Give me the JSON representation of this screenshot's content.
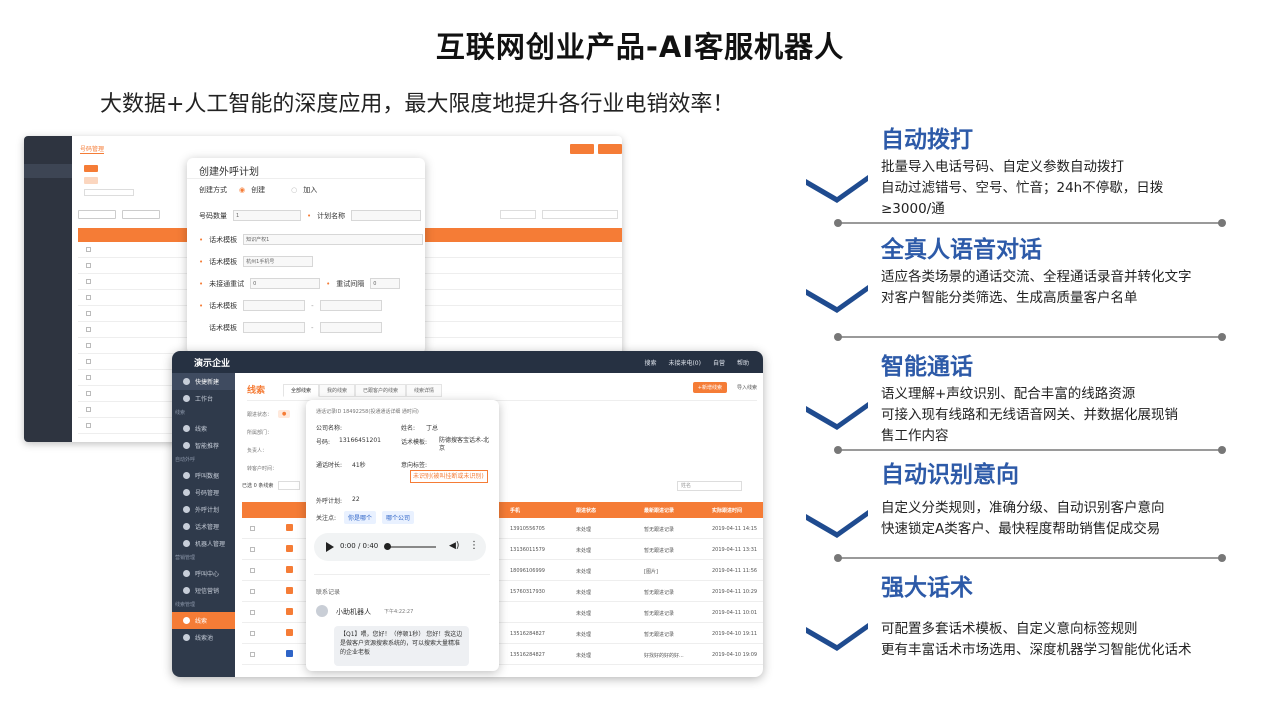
{
  "header": {
    "title": "互联网创业产品-AI客服机器人",
    "subtitle": "大数据+人工智能的深度应用，最大限度地提升各行业电销效率！"
  },
  "shot1": {
    "tabs": [
      "号码管理"
    ],
    "modal": {
      "title": "创建外呼计划",
      "mode_label": "创建方式",
      "mode_create": "创建",
      "mode_join": "加入",
      "count_label": "号码数量",
      "count_value": "1",
      "plan_name_label": "计划名称",
      "script_template_label": "话术模板",
      "script_template_value": "知识产权1",
      "sms_template_label": "话术模板",
      "sms_template_value": "杭州1手机号",
      "unanswered_label": "未接通重试",
      "unanswered_value": "0",
      "interval_label": "重试间隔",
      "interval_value": "0",
      "template3_label": "话术模板",
      "template4_label": "话术模板"
    }
  },
  "shot2": {
    "brand": "演示企业",
    "topnav": [
      "搜索",
      "未接来电(0)",
      "自营",
      "帮助"
    ],
    "sidebar": {
      "quick": "快捷新建",
      "items": [
        {
          "section": "",
          "label": "工作台"
        },
        {
          "section": "线索",
          "label": ""
        },
        {
          "section": "",
          "label": "线索"
        }
      ],
      "sections": [
        "自动外呼",
        "营销管理",
        "线索管理"
      ],
      "menu": [
        "工作台",
        "线索",
        "智能推荐",
        "呼叫数据",
        "号码管理",
        "外呼计划",
        "话术管理",
        "机器人管理",
        "呼叫中心",
        "短信营销",
        "线索",
        "线索池"
      ]
    },
    "page_title": "线索",
    "tabs": [
      "全部线索",
      "我的线索",
      "已跟客户的线索",
      "线索详情"
    ],
    "new_button": "+新增线索",
    "import_button": "导入线索",
    "filters": [
      "跟进状态：",
      "所属部门：",
      "负责人：",
      "转客户时间："
    ],
    "selected": "已选 0 条线索",
    "search_placeholder": "姓名",
    "table_headers": [
      "手机",
      "跟进状态",
      "最新跟进记录",
      "实际跟进时间"
    ],
    "rows": [
      {
        "phone": "13910556705",
        "status": "未处理",
        "record": "暂无跟进记录",
        "time": "2019-04-11 14:15"
      },
      {
        "phone": "13136011579",
        "status": "未处理",
        "record": "暂无跟进记录",
        "time": "2019-04-11 13:31"
      },
      {
        "phone": "18096106999",
        "status": "未处理",
        "record": "[图片]",
        "time": "2019-04-11 11:56"
      },
      {
        "phone": "15760317930",
        "status": "未处理",
        "record": "暂无跟进记录",
        "time": "2019-04-11 10:29"
      },
      {
        "phone": "",
        "status": "未处理",
        "record": "暂无跟进记录",
        "time": "2019-04-11 10:01"
      },
      {
        "phone": "13516284827",
        "status": "未处理",
        "record": "暂无跟进记录",
        "time": "2019-04-10 19:11"
      },
      {
        "phone": "13516284827",
        "status": "未处理",
        "record": "好找好的好的好...",
        "time": "2019-04-10 19:09"
      }
    ],
    "popup": {
      "record_id": "通话记录ID 18492258(投通通话详细 通时间)",
      "company_label": "公司名称:",
      "name_label": "姓名:",
      "name_value": "丁总",
      "phone_label": "号码:",
      "phone_value": "13166451201",
      "template_label": "话术模板:",
      "template_value": "防德搜客宝话术-北京",
      "duration_label": "通话时长:",
      "duration_value": "41秒",
      "intent_label": "意向标签:",
      "intent_value": "未识别(被叫挂断或未识别)",
      "round_label": "外呼计划:",
      "round_value": "22",
      "focus_label": "关注点:",
      "focus_tags": [
        "你是哪个",
        "哪个公司"
      ],
      "audio_time": "0:00 / 0:40",
      "contact_title": "联系记录",
      "bot_name": "小助机器人",
      "bot_time": "下午4:22:27",
      "chat_text": "【Q1】喂，您好！（停顿1秒） 您好！我这边是做客户资源搜索系统的，可以搜索大量精准的企业老板"
    }
  },
  "features": [
    {
      "title": "自动拨打",
      "lines": [
        "批量导入电话号码、自定义参数自动拨打",
        "自动过滤错号、空号、忙音；24h不停歇，日拨",
        "≥3000/通"
      ]
    },
    {
      "title": "全真人语音对话",
      "lines": [
        "适应各类场景的通话交流、全程通话录音并转化文字",
        "对客户智能分类筛选、生成高质量客户名单"
      ]
    },
    {
      "title": "智能通话",
      "lines": [
        "语义理解+声纹识别、配合丰富的线路资源",
        "可接入现有线路和无线语音网关、并数据化展现销",
        "售工作内容"
      ]
    },
    {
      "title": "自动识别意向",
      "lines": [
        "自定义分类规则，准确分级、自动识别客户意向",
        "快速锁定A类客户、最快程度帮助销售促成交易"
      ]
    },
    {
      "title": "强大话术",
      "lines": [
        "可配置多套话术模板、自定义意向标签规则",
        "更有丰富话术市场选用、深度机器学习智能优化话术"
      ]
    }
  ],
  "colors": {
    "accent": "#f57c36",
    "title_blue": "#2d5aa8",
    "chevron": "#1f4b8f",
    "sidebar": "#2f3a4b"
  }
}
